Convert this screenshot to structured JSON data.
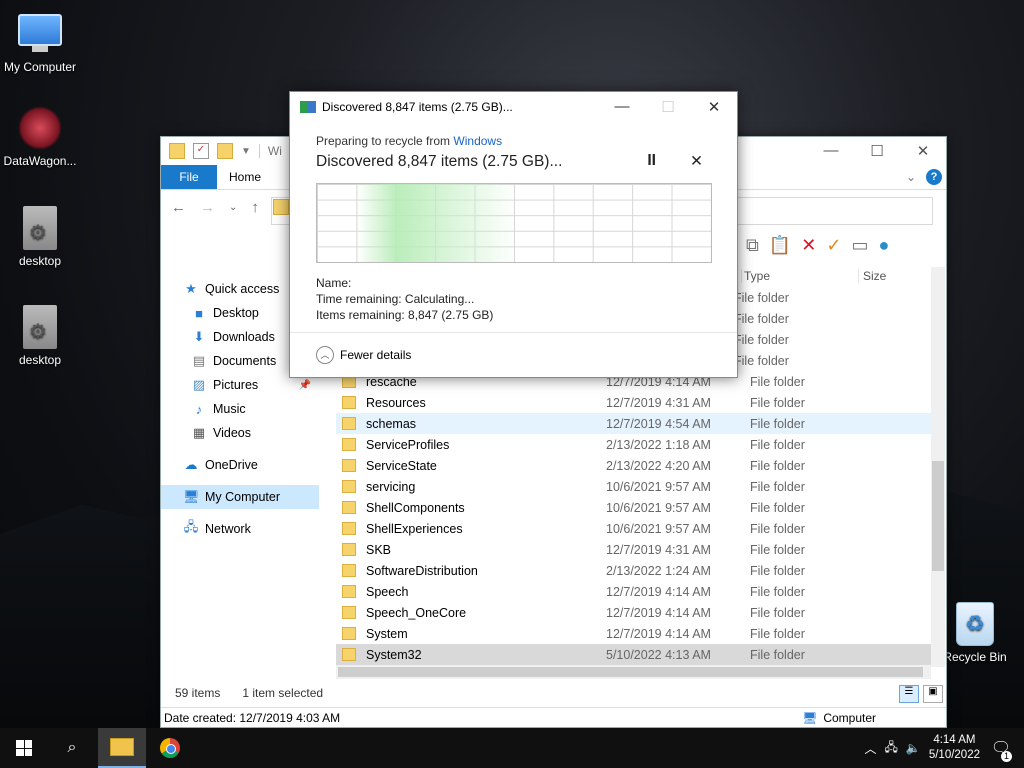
{
  "desktop": {
    "icons": [
      {
        "label": "My Computer"
      },
      {
        "label": "DataWagon..."
      },
      {
        "label": "desktop"
      },
      {
        "label": "desktop"
      },
      {
        "label": "Recycle Bin"
      }
    ]
  },
  "explorer": {
    "title": "Wi",
    "tabs": {
      "file": "File",
      "home": "Home"
    },
    "columns": {
      "type": "Type",
      "size": "Size"
    },
    "sidebar": [
      {
        "label": "Quick access",
        "icon": "star-icon"
      },
      {
        "label": "Desktop",
        "icon": "desktop-icon"
      },
      {
        "label": "Downloads",
        "icon": "download-icon"
      },
      {
        "label": "Documents",
        "icon": "document-icon"
      },
      {
        "label": "Pictures",
        "icon": "picture-icon"
      },
      {
        "label": "Music",
        "icon": "music-icon"
      },
      {
        "label": "Videos",
        "icon": "video-icon"
      },
      {
        "label": "OneDrive",
        "icon": "cloud-icon"
      },
      {
        "label": "My Computer",
        "icon": "computer-icon"
      },
      {
        "label": "Network",
        "icon": "network-icon"
      }
    ],
    "files": [
      {
        "name": "",
        "date": "",
        "type": "File folder"
      },
      {
        "name": "",
        "date": "",
        "type": "File folder"
      },
      {
        "name": "",
        "date": "",
        "type": "File folder"
      },
      {
        "name": "",
        "date": "",
        "type": "File folder"
      },
      {
        "name": "rescache",
        "date": "12/7/2019 4:14 AM",
        "type": "File folder"
      },
      {
        "name": "Resources",
        "date": "12/7/2019 4:31 AM",
        "type": "File folder"
      },
      {
        "name": "schemas",
        "date": "12/7/2019 4:54 AM",
        "type": "File folder"
      },
      {
        "name": "ServiceProfiles",
        "date": "2/13/2022 1:18 AM",
        "type": "File folder"
      },
      {
        "name": "ServiceState",
        "date": "2/13/2022 4:20 AM",
        "type": "File folder"
      },
      {
        "name": "servicing",
        "date": "10/6/2021 9:57 AM",
        "type": "File folder"
      },
      {
        "name": "ShellComponents",
        "date": "10/6/2021 9:57 AM",
        "type": "File folder"
      },
      {
        "name": "ShellExperiences",
        "date": "10/6/2021 9:57 AM",
        "type": "File folder"
      },
      {
        "name": "SKB",
        "date": "12/7/2019 4:31 AM",
        "type": "File folder"
      },
      {
        "name": "SoftwareDistribution",
        "date": "2/13/2022 1:24 AM",
        "type": "File folder"
      },
      {
        "name": "Speech",
        "date": "12/7/2019 4:14 AM",
        "type": "File folder"
      },
      {
        "name": "Speech_OneCore",
        "date": "12/7/2019 4:14 AM",
        "type": "File folder"
      },
      {
        "name": "System",
        "date": "12/7/2019 4:14 AM",
        "type": "File folder"
      },
      {
        "name": "System32",
        "date": "5/10/2022 4:13 AM",
        "type": "File folder"
      }
    ],
    "status": {
      "items": "59 items",
      "selected": "1 item selected"
    },
    "details": {
      "date_created": "Date created: 12/7/2019 4:03 AM",
      "location": "Computer"
    }
  },
  "dialog": {
    "title": "Discovered 8,847 items (2.75 GB)...",
    "preparing": "Preparing to recycle from",
    "source": "Windows",
    "headline": "Discovered 8,847 items (2.75 GB)...",
    "name_label": "Name:",
    "time_remaining": "Time remaining:  Calculating...",
    "items_remaining": "Items remaining:  8,847 (2.75 GB)",
    "fewer_details": "Fewer details",
    "pause": "II",
    "cancel": "✕"
  },
  "taskbar": {
    "time": "4:14 AM",
    "date": "5/10/2022",
    "notifications": "1"
  }
}
